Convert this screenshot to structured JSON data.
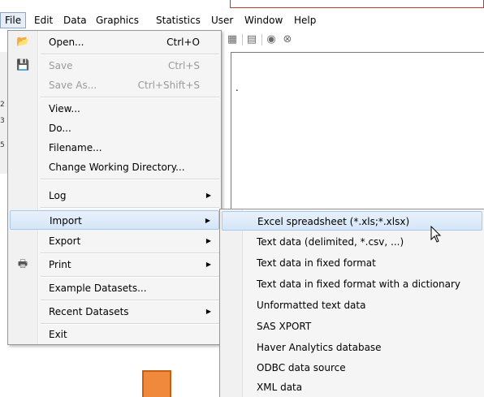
{
  "menubar": {
    "items": [
      "File",
      "Edit",
      "Data",
      "Graphics",
      "Statistics",
      "User",
      "Window",
      "Help"
    ]
  },
  "file_menu": {
    "items": [
      {
        "label": "Open...",
        "shortcut": "Ctrl+O",
        "icon": "folder-open-icon"
      },
      {
        "label": "Save",
        "shortcut": "Ctrl+S",
        "icon": "floppy-disk-icon",
        "disabled": true
      },
      {
        "label": "Save As...",
        "shortcut": "Ctrl+Shift+S",
        "disabled": true
      },
      {
        "label": "View..."
      },
      {
        "label": "Do..."
      },
      {
        "label": "Filename..."
      },
      {
        "label": "Change Working Directory..."
      },
      {
        "label": "Log",
        "submenu": true
      },
      {
        "label": "Import",
        "submenu": true,
        "highlighted": true
      },
      {
        "label": "Export",
        "submenu": true
      },
      {
        "label": "Print",
        "submenu": true,
        "icon": "printer-icon"
      },
      {
        "label": "Example Datasets..."
      },
      {
        "label": "Recent Datasets",
        "submenu": true
      },
      {
        "label": "Exit"
      }
    ]
  },
  "import_menu": {
    "items": [
      {
        "label": "Excel spreadsheet (*.xls;*.xlsx)",
        "highlighted": true
      },
      {
        "label": "Text data (delimited, *.csv, ...)"
      },
      {
        "label": "Text data in fixed format"
      },
      {
        "label": "Text data in fixed format with a dictionary"
      },
      {
        "label": "Unformatted text data"
      },
      {
        "label": "SAS XPORT"
      },
      {
        "label": "Haver Analytics database"
      },
      {
        "label": "ODBC data source"
      },
      {
        "label": "XML data"
      }
    ]
  },
  "workspace": {
    "text": "."
  },
  "colors": {
    "highlight": "#d5e6f8",
    "highlight_border": "#a8c8ec",
    "menu_bg": "#f5f5f5",
    "orange": "#f0893c"
  }
}
